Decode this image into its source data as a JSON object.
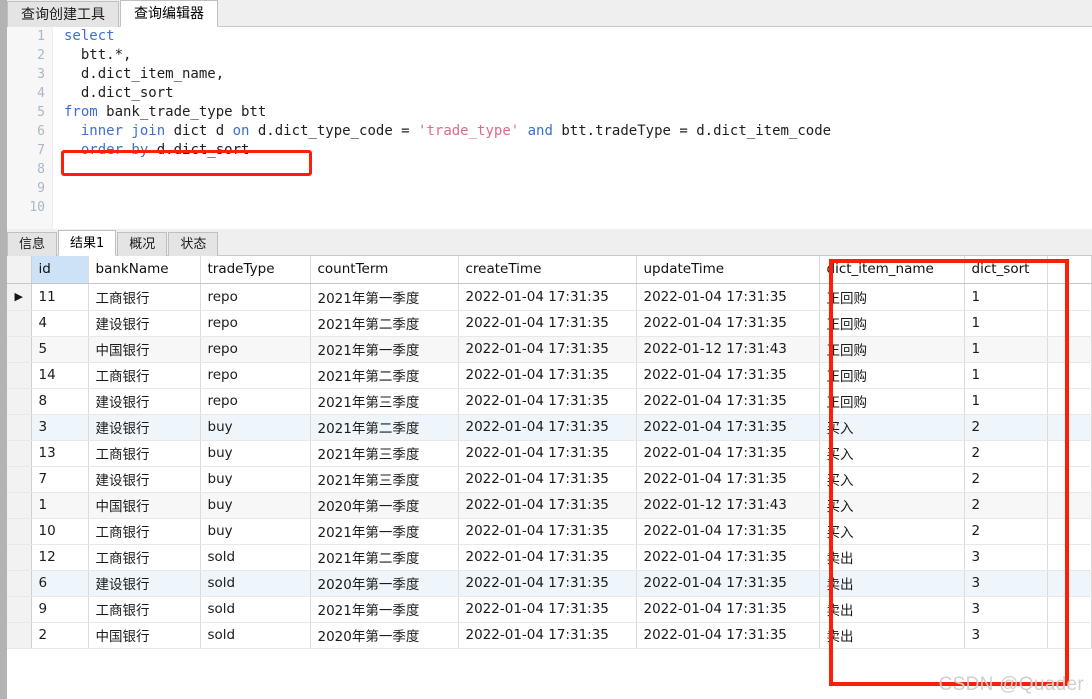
{
  "editor_tabs": [
    {
      "label": "查询创建工具",
      "active": false
    },
    {
      "label": "查询编辑器",
      "active": true
    }
  ],
  "sql": {
    "lines": [
      {
        "no": "1",
        "tokens": [
          {
            "t": "select",
            "c": "kw"
          }
        ]
      },
      {
        "no": "2",
        "tokens": [
          {
            "t": "  btt.*,",
            "c": ""
          }
        ]
      },
      {
        "no": "3",
        "tokens": [
          {
            "t": "  d.dict_item_name,",
            "c": ""
          }
        ]
      },
      {
        "no": "4",
        "tokens": [
          {
            "t": "  d.dict_sort",
            "c": ""
          }
        ]
      },
      {
        "no": "5",
        "tokens": [
          {
            "t": "from",
            "c": "kw"
          },
          {
            "t": " bank_trade_type btt",
            "c": ""
          }
        ]
      },
      {
        "no": "6",
        "tokens": [
          {
            "t": "  ",
            "c": ""
          },
          {
            "t": "inner join",
            "c": "kw"
          },
          {
            "t": " dict d ",
            "c": ""
          },
          {
            "t": "on",
            "c": "kw"
          },
          {
            "t": " d.dict_type_code = ",
            "c": ""
          },
          {
            "t": "'trade_type'",
            "c": "str"
          },
          {
            "t": " ",
            "c": ""
          },
          {
            "t": "and",
            "c": "kw"
          },
          {
            "t": " btt.tradeType = d.dict_item_code",
            "c": ""
          }
        ]
      },
      {
        "no": "7",
        "tokens": [
          {
            "t": "  ",
            "c": ""
          },
          {
            "t": "order by",
            "c": "kw"
          },
          {
            "t": " d.dict_sort",
            "c": ""
          }
        ]
      },
      {
        "no": "8",
        "tokens": [
          {
            "t": "",
            "c": ""
          }
        ]
      },
      {
        "no": "9",
        "tokens": [
          {
            "t": "",
            "c": ""
          }
        ]
      },
      {
        "no": "10",
        "tokens": [
          {
            "t": "",
            "c": ""
          }
        ]
      }
    ],
    "highlight_note": "order by d.dict_sort"
  },
  "result_tabs": [
    {
      "label": "信息",
      "active": false
    },
    {
      "label": "结果1",
      "active": true
    },
    {
      "label": "概况",
      "active": false
    },
    {
      "label": "状态",
      "active": false
    }
  ],
  "grid": {
    "columns": [
      {
        "key": "id",
        "label": "id",
        "cls": "c-id",
        "selected": true,
        "numeric": true
      },
      {
        "key": "bankName",
        "label": "bankName",
        "cls": "c-bank",
        "selected": false,
        "numeric": false
      },
      {
        "key": "tradeType",
        "label": "tradeType",
        "cls": "c-tt",
        "selected": false,
        "numeric": false
      },
      {
        "key": "countTerm",
        "label": "countTerm",
        "cls": "c-ct",
        "selected": false,
        "numeric": false
      },
      {
        "key": "createTime",
        "label": "createTime",
        "cls": "c-crt",
        "selected": false,
        "numeric": false
      },
      {
        "key": "updateTime",
        "label": "updateTime",
        "cls": "c-upd",
        "selected": false,
        "numeric": false
      },
      {
        "key": "dict_item_name",
        "label": "dict_item_name",
        "cls": "c-din",
        "selected": false,
        "numeric": false
      },
      {
        "key": "dict_sort",
        "label": "dict_sort",
        "cls": "c-ds",
        "selected": false,
        "numeric": false
      }
    ],
    "current_row_index": 0,
    "rows": [
      {
        "id": "11",
        "bankName": "工商银行",
        "tradeType": "repo",
        "countTerm": "2021年第一季度",
        "createTime": "2022-01-04 17:31:35",
        "updateTime": "2022-01-04 17:31:35",
        "dict_item_name": "正回购",
        "dict_sort": "1",
        "shade": ""
      },
      {
        "id": "4",
        "bankName": "建设银行",
        "tradeType": "repo",
        "countTerm": "2021年第二季度",
        "createTime": "2022-01-04 17:31:35",
        "updateTime": "2022-01-04 17:31:35",
        "dict_item_name": "正回购",
        "dict_sort": "1",
        "shade": ""
      },
      {
        "id": "5",
        "bankName": "中国银行",
        "tradeType": "repo",
        "countTerm": "2021年第一季度",
        "createTime": "2022-01-04 17:31:35",
        "updateTime": "2022-01-12 17:31:43",
        "dict_item_name": "正回购",
        "dict_sort": "1",
        "shade": "alt"
      },
      {
        "id": "14",
        "bankName": "工商银行",
        "tradeType": "repo",
        "countTerm": "2021年第二季度",
        "createTime": "2022-01-04 17:31:35",
        "updateTime": "2022-01-04 17:31:35",
        "dict_item_name": "正回购",
        "dict_sort": "1",
        "shade": ""
      },
      {
        "id": "8",
        "bankName": "建设银行",
        "tradeType": "repo",
        "countTerm": "2021年第三季度",
        "createTime": "2022-01-04 17:31:35",
        "updateTime": "2022-01-04 17:31:35",
        "dict_item_name": "正回购",
        "dict_sort": "1",
        "shade": ""
      },
      {
        "id": "3",
        "bankName": "建设银行",
        "tradeType": "buy",
        "countTerm": "2021年第二季度",
        "createTime": "2022-01-04 17:31:35",
        "updateTime": "2022-01-04 17:31:35",
        "dict_item_name": "买入",
        "dict_sort": "2",
        "shade": "alt2"
      },
      {
        "id": "13",
        "bankName": "工商银行",
        "tradeType": "buy",
        "countTerm": "2021年第三季度",
        "createTime": "2022-01-04 17:31:35",
        "updateTime": "2022-01-04 17:31:35",
        "dict_item_name": "买入",
        "dict_sort": "2",
        "shade": ""
      },
      {
        "id": "7",
        "bankName": "建设银行",
        "tradeType": "buy",
        "countTerm": "2021年第三季度",
        "createTime": "2022-01-04 17:31:35",
        "updateTime": "2022-01-04 17:31:35",
        "dict_item_name": "买入",
        "dict_sort": "2",
        "shade": ""
      },
      {
        "id": "1",
        "bankName": "中国银行",
        "tradeType": "buy",
        "countTerm": "2020年第一季度",
        "createTime": "2022-01-04 17:31:35",
        "updateTime": "2022-01-12 17:31:43",
        "dict_item_name": "买入",
        "dict_sort": "2",
        "shade": "alt"
      },
      {
        "id": "10",
        "bankName": "工商银行",
        "tradeType": "buy",
        "countTerm": "2021年第一季度",
        "createTime": "2022-01-04 17:31:35",
        "updateTime": "2022-01-04 17:31:35",
        "dict_item_name": "买入",
        "dict_sort": "2",
        "shade": ""
      },
      {
        "id": "12",
        "bankName": "工商银行",
        "tradeType": "sold",
        "countTerm": "2021年第二季度",
        "createTime": "2022-01-04 17:31:35",
        "updateTime": "2022-01-04 17:31:35",
        "dict_item_name": "卖出",
        "dict_sort": "3",
        "shade": ""
      },
      {
        "id": "6",
        "bankName": "建设银行",
        "tradeType": "sold",
        "countTerm": "2020年第一季度",
        "createTime": "2022-01-04 17:31:35",
        "updateTime": "2022-01-04 17:31:35",
        "dict_item_name": "卖出",
        "dict_sort": "3",
        "shade": "alt2"
      },
      {
        "id": "9",
        "bankName": "工商银行",
        "tradeType": "sold",
        "countTerm": "2021年第一季度",
        "createTime": "2022-01-04 17:31:35",
        "updateTime": "2022-01-04 17:31:35",
        "dict_item_name": "卖出",
        "dict_sort": "3",
        "shade": ""
      },
      {
        "id": "2",
        "bankName": "中国银行",
        "tradeType": "sold",
        "countTerm": "2020年第一季度",
        "createTime": "2022-01-04 17:31:35",
        "updateTime": "2022-01-04 17:31:35",
        "dict_item_name": "卖出",
        "dict_sort": "3",
        "shade": ""
      }
    ]
  },
  "annotations": {
    "highlight_color": "#fb1f09"
  },
  "watermark": "CSDN @Quader"
}
